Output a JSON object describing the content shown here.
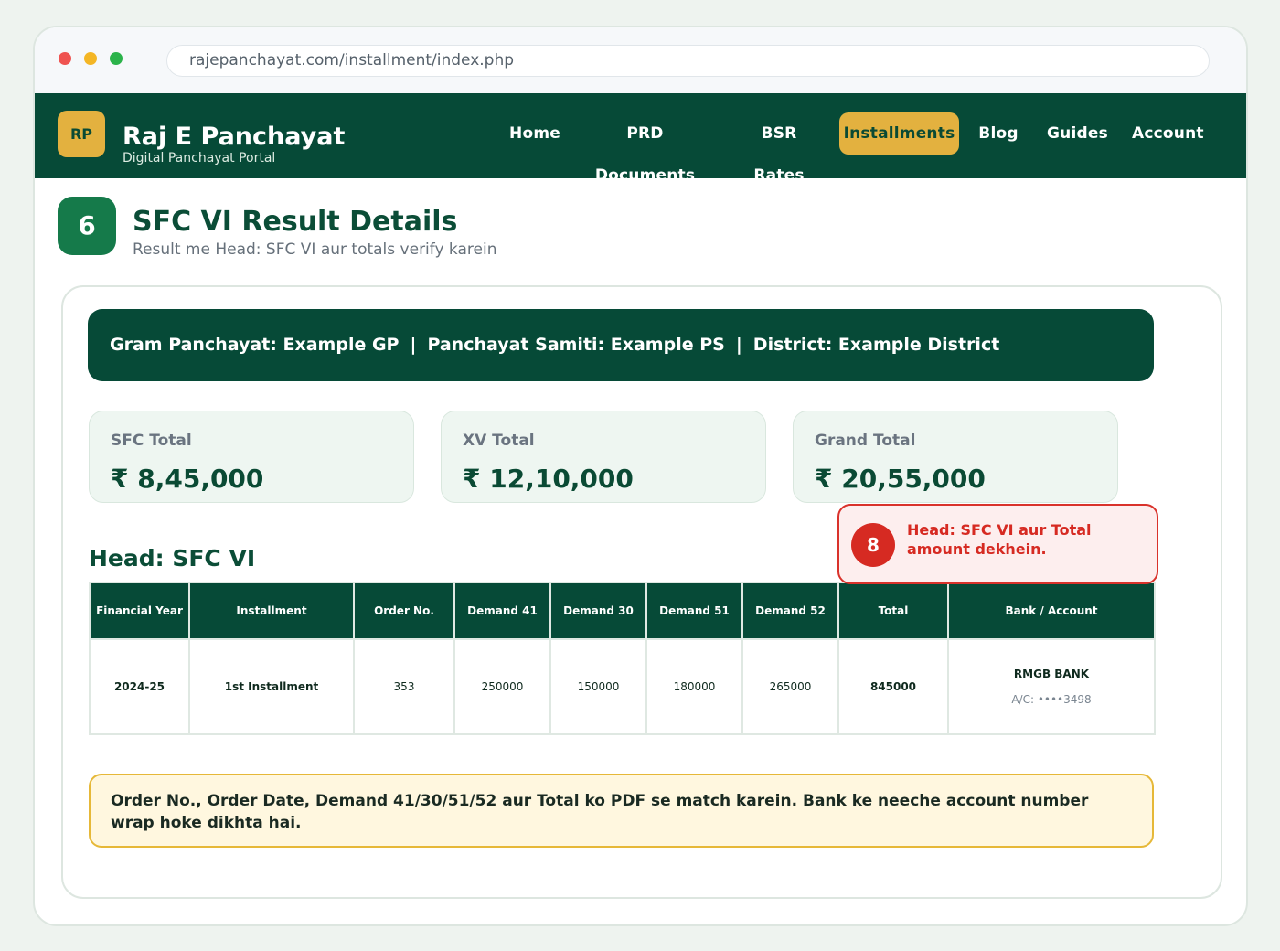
{
  "browser": {
    "url": "rajepanchayat.com/installment/index.php"
  },
  "brand": {
    "logo_text": "RP",
    "title": "Raj E Panchayat",
    "subtitle": "Digital Panchayat Portal"
  },
  "nav": {
    "items": [
      {
        "label": "Home"
      },
      {
        "label": "PRD Documents"
      },
      {
        "label": "BSR Rates"
      },
      {
        "label": "Installments",
        "active": true
      },
      {
        "label": "Blog"
      },
      {
        "label": "Guides"
      },
      {
        "label": "Account"
      }
    ]
  },
  "step": {
    "number": "6",
    "title": "SFC VI Result Details",
    "subtitle": "Result me Head: SFC VI aur totals verify karein"
  },
  "location": {
    "gram_panchayat": "Gram Panchayat: Example GP",
    "panchayat_samiti": "Panchayat Samiti: Example PS",
    "district": "District: Example District",
    "separator": "|"
  },
  "stats": [
    {
      "label": "SFC Total",
      "value": "₹ 8,45,000"
    },
    {
      "label": "XV Total",
      "value": "₹ 12,10,000"
    },
    {
      "label": "Grand Total",
      "value": "₹ 20,55,000"
    }
  ],
  "head": {
    "title": "Head: SFC VI"
  },
  "callout": {
    "number": "8",
    "text": "Head: SFC VI aur Total amount dekhein."
  },
  "table": {
    "columns": [
      "Financial Year",
      "Installment",
      "Order No.",
      "Demand 41",
      "Demand 30",
      "Demand 51",
      "Demand 52",
      "Total",
      "Bank / Account"
    ],
    "rows": [
      {
        "financial_year": "2024-25",
        "installment": "1st Installment",
        "order_no": "353",
        "demand_41": "250000",
        "demand_30": "150000",
        "demand_51": "180000",
        "demand_52": "265000",
        "total": "845000",
        "bank": "RMGB BANK",
        "account": "A/C: ••••3498"
      }
    ]
  },
  "note": {
    "text": "Order No., Order Date, Demand 41/30/51/52 aur Total ko PDF se match karein. Bank ke neeche account number wrap hoke dikhta hai."
  },
  "colors": {
    "primary": "#064a37",
    "accent": "#e3b13f",
    "alert": "#d62a22",
    "note_bg": "#fff7df"
  }
}
